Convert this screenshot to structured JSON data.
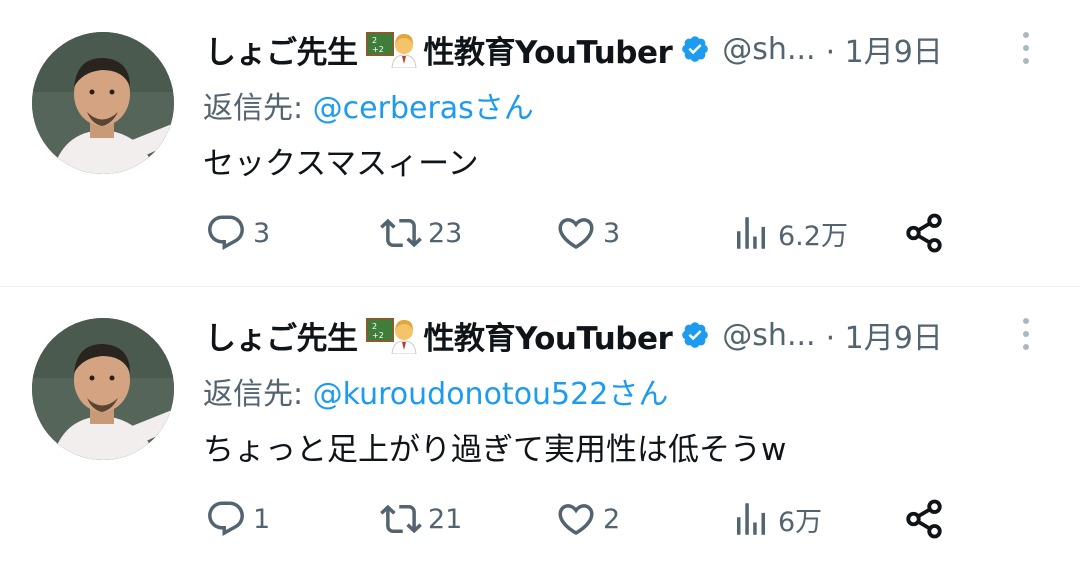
{
  "tweets": [
    {
      "display_name": "しょご先生",
      "title": "性教育YouTuber",
      "handle": "@sh...",
      "date": "· 1月9日",
      "reply_prefix": "返信先: ",
      "reply_to": "@cerberasさん",
      "text": "セックスマスィーン",
      "replies": "3",
      "retweets": "23",
      "likes": "3",
      "views": "6.2万"
    },
    {
      "display_name": "しょご先生",
      "title": "性教育YouTuber",
      "handle": "@sh...",
      "date": "· 1月9日",
      "reply_prefix": "返信先: ",
      "reply_to": "@kuroudonotou522さん",
      "text": "ちょっと足上がり過ぎて実用性は低そうw",
      "replies": "1",
      "retweets": "21",
      "likes": "2",
      "views": "6万"
    }
  ],
  "colors": {
    "link": "#1d9bf0",
    "muted": "#536471",
    "text": "#0f1419"
  },
  "icons": [
    "reply-icon",
    "retweet-icon",
    "like-icon",
    "views-icon",
    "share-icon",
    "verified-badge-icon",
    "more-icon",
    "teacher-emoji-icon"
  ]
}
